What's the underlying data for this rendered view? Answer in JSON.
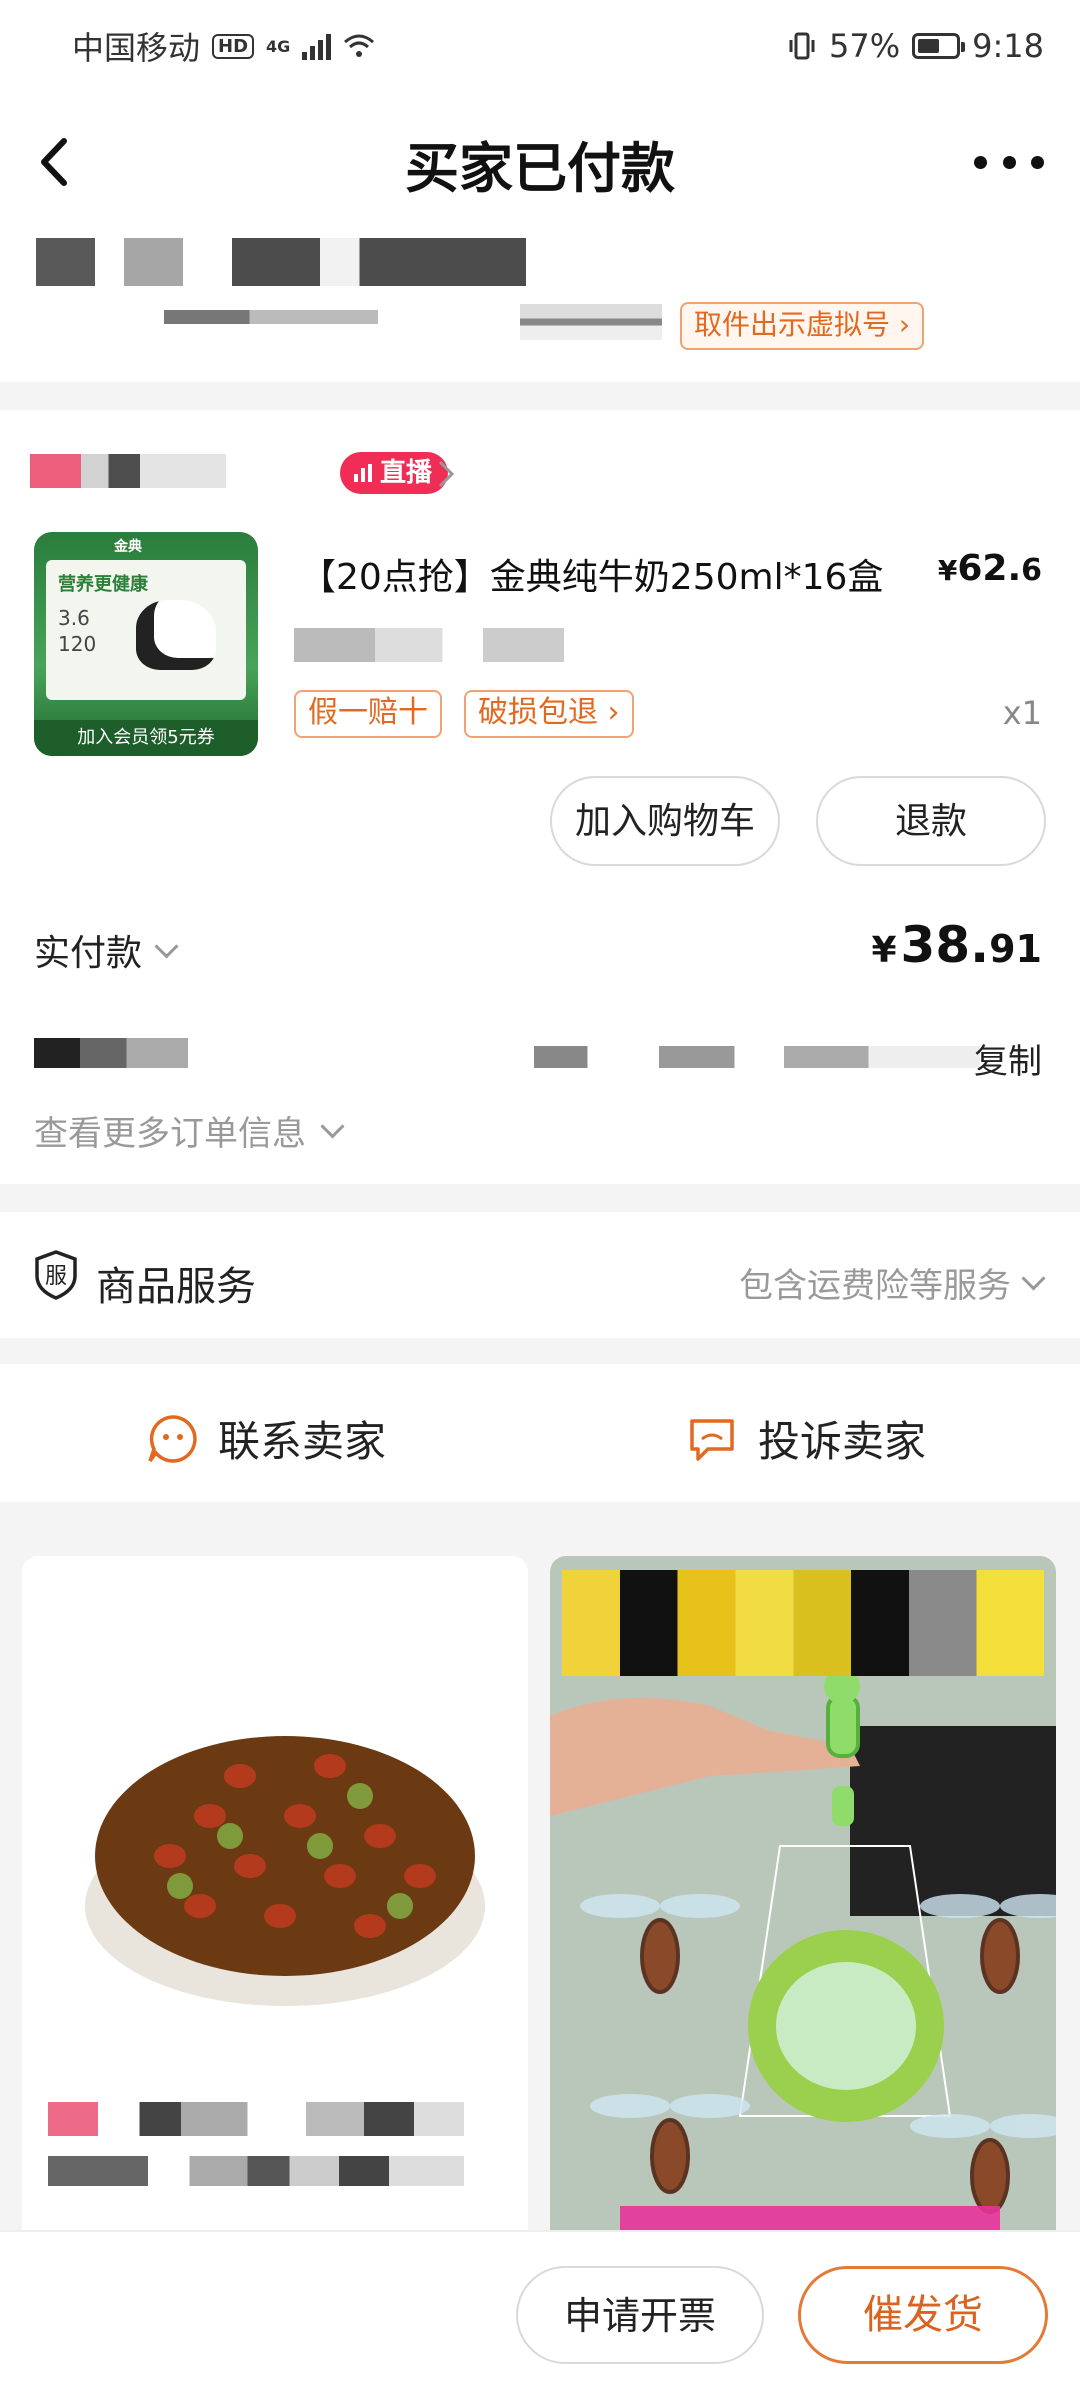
{
  "status_bar": {
    "carrier": "中国移动",
    "hd": "HD",
    "network": "4G",
    "battery": "57%",
    "battery_level": 0.57,
    "time": "9:18"
  },
  "header": {
    "title": "买家已付款"
  },
  "delivery": {
    "pickup_button": "取件出示虚拟号 ›"
  },
  "store": {
    "live_badge": "直播"
  },
  "product": {
    "title": "【20点抢】金典纯牛奶250ml*16盒",
    "price_symbol": "¥",
    "price_int": "62.",
    "price_dec": "6",
    "tags": [
      "假一赔十",
      "破损包退 ›"
    ],
    "quantity": "x1",
    "thumb_top": "金典",
    "thumb_line1": "营养更健康",
    "thumb_line2": "3.6",
    "thumb_line3": "120",
    "thumb_banner": "加入会员领5元券"
  },
  "actions": {
    "add_to_cart": "加入购物车",
    "refund": "退款"
  },
  "payment": {
    "label": "实付款",
    "symbol": "¥",
    "amount_int": "38.",
    "amount_dec": "91"
  },
  "order": {
    "copy": "复制",
    "more_info": "查看更多订单信息"
  },
  "service": {
    "title": "商品服务",
    "icon_char": "服",
    "desc": "包含运费险等服务"
  },
  "contact": {
    "contact_seller": "联系卖家",
    "complain_seller": "投诉卖家"
  },
  "bottom": {
    "invoice": "申请开票",
    "urge": "催发货"
  },
  "colors": {
    "accent": "#e2691f",
    "live_red": "#ef2d55"
  }
}
